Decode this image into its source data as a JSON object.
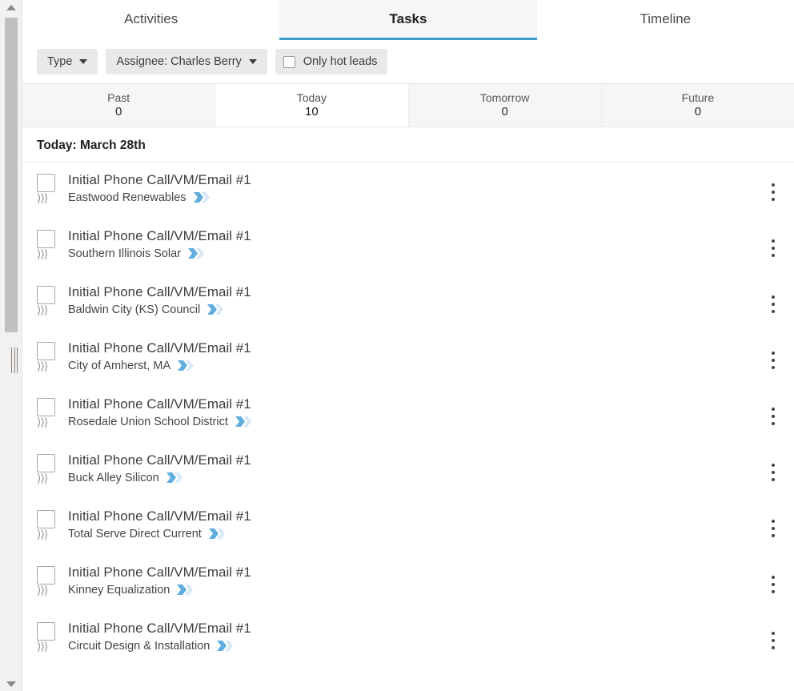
{
  "colors": {
    "accent": "#3d9dcd",
    "stage_filled": "#61aede",
    "stage_empty": "#d6e9f5",
    "chip_bg": "#e9e9e9",
    "active_tab_bg": "#f6f6f6",
    "segment_bg": "#f6f6f6"
  },
  "scrollbar": {
    "up_arrow_icon": "triangle-up-icon",
    "down_arrow_icon": "triangle-down-icon",
    "thumb_icon": "scrollbar-thumb",
    "grip_icon": "drag-handle-icon"
  },
  "tabs": [
    {
      "label": "Activities",
      "active": false
    },
    {
      "label": "Tasks",
      "active": true
    },
    {
      "label": "Timeline",
      "active": false
    }
  ],
  "filters": {
    "type": {
      "label": "Type",
      "icon": "chevron-down-icon"
    },
    "assignee": {
      "label": "Assignee: Charles Berry",
      "icon": "chevron-down-icon"
    },
    "hot_leads": {
      "label": "Only hot leads",
      "checked": false,
      "icon": "checkbox-icon"
    }
  },
  "periods": [
    {
      "label": "Past",
      "count": "0",
      "active": false
    },
    {
      "label": "Today",
      "count": "10",
      "active": true
    },
    {
      "label": "Tomorrow",
      "count": "0",
      "active": false
    },
    {
      "label": "Future",
      "count": "0",
      "active": false
    }
  ],
  "day_header": "Today: March 28th",
  "row_icons": {
    "chevrons": "⟩⟩⟩",
    "chevrons_name": "triple-chevron-icon",
    "stage_badge_name": "stage-progress-icon",
    "kebab_name": "more-options-icon",
    "checkbox_name": "task-complete-checkbox"
  },
  "tasks": [
    {
      "title": "Initial Phone Call/VM/Email #1",
      "company": "Eastwood Renewables",
      "done": false
    },
    {
      "title": "Initial Phone Call/VM/Email #1",
      "company": "Southern Illinois Solar",
      "done": false
    },
    {
      "title": "Initial Phone Call/VM/Email #1",
      "company": "Baldwin City (KS) Council",
      "done": false
    },
    {
      "title": "Initial Phone Call/VM/Email #1",
      "company": "City of Amherst, MA",
      "done": false
    },
    {
      "title": "Initial Phone Call/VM/Email #1",
      "company": "Rosedale Union School District",
      "done": false
    },
    {
      "title": "Initial Phone Call/VM/Email #1",
      "company": "Buck Alley Silicon",
      "done": false
    },
    {
      "title": "Initial Phone Call/VM/Email #1",
      "company": "Total Serve Direct Current",
      "done": false
    },
    {
      "title": "Initial Phone Call/VM/Email #1",
      "company": "Kinney Equalization",
      "done": false
    },
    {
      "title": "Initial Phone Call/VM/Email #1",
      "company": "Circuit Design & Installation",
      "done": false
    }
  ]
}
